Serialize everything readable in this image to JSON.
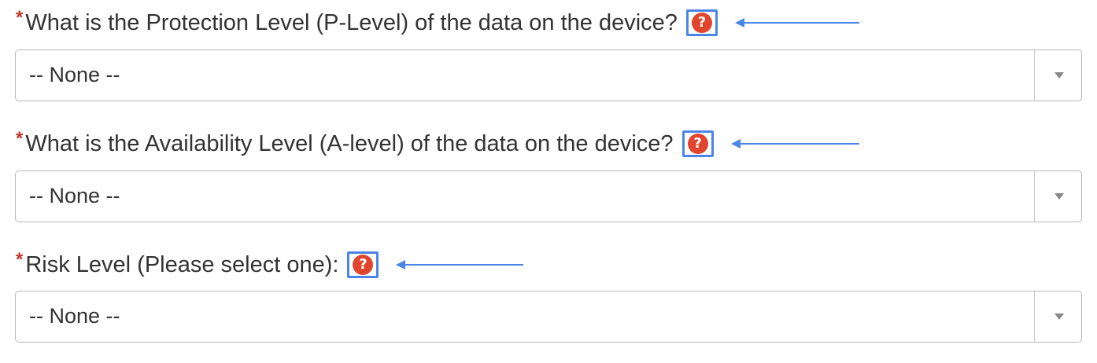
{
  "fields": [
    {
      "required_marker": "*",
      "label": "What is the Protection Level (P-Level) of the data on the device?",
      "help_icon": "question-circle-icon",
      "select_value": "-- None --"
    },
    {
      "required_marker": "*",
      "label": "What is the Availability Level (A-level) of the data on the device?",
      "help_icon": "question-circle-icon",
      "select_value": "-- None --"
    },
    {
      "required_marker": "*",
      "label": "Risk Level (Please select one):",
      "help_icon": "question-circle-icon",
      "select_value": "-- None --"
    }
  ],
  "help_glyph": "?",
  "colors": {
    "required": "#c0392b",
    "help_icon_bg": "#e1452d",
    "annotation_blue": "#4a86e8",
    "text": "#333333",
    "select_border": "#b8b8b8"
  }
}
